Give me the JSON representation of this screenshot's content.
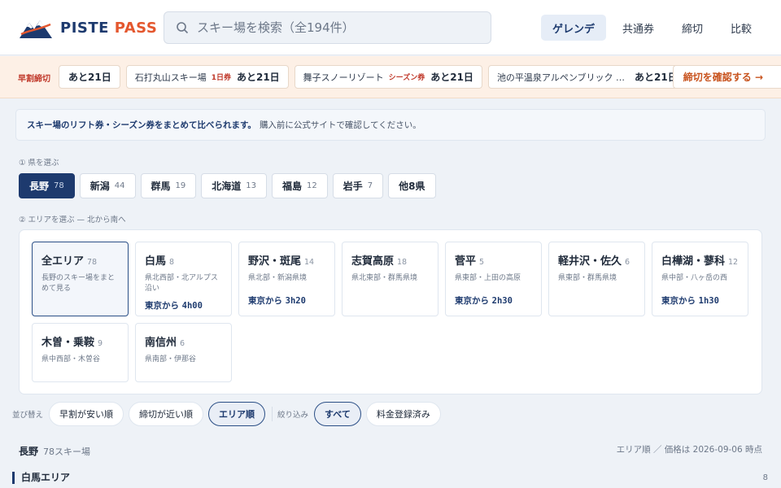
{
  "brand": {
    "name_main": "PISTE ",
    "name_accent": "PASS"
  },
  "search": {
    "placeholder": "スキー場を検索（全194件）"
  },
  "nav": [
    {
      "label": "ゲレンデ",
      "active": true
    },
    {
      "label": "共通券"
    },
    {
      "label": "締切"
    },
    {
      "label": "比較"
    }
  ],
  "ticker": {
    "label": "早割締切",
    "items": [
      {
        "name": "",
        "type": "",
        "deadline": "あと21日"
      },
      {
        "name": "石打丸山スキー場",
        "type": "1日券",
        "deadline": "あと21日"
      },
      {
        "name": "舞子スノーリゾート",
        "type": "シーズン券",
        "deadline": "あと21日"
      },
      {
        "name": "池の平温泉アルペンブリック …",
        "type": "",
        "deadline": "あと21日"
      }
    ],
    "cta": "締切を確認する →"
  },
  "notice": {
    "strong": "スキー場のリフト券・シーズン券をまとめて比べられます。",
    "rest": "購入前に公式サイトで確認してください。"
  },
  "step1": "① 県を選ぶ",
  "step2": "② エリアを選ぶ — 北から南へ",
  "prefectures": [
    {
      "name": "長野",
      "count": "78",
      "active": true
    },
    {
      "name": "新潟",
      "count": "44"
    },
    {
      "name": "群馬",
      "count": "19"
    },
    {
      "name": "北海道",
      "count": "13"
    },
    {
      "name": "福島",
      "count": "12"
    },
    {
      "name": "岩手",
      "count": "7"
    },
    {
      "name": "他8県",
      "count": ""
    }
  ],
  "areas": [
    {
      "name": "全エリア",
      "count": "78",
      "desc": "長野のスキー場をまとめて見る",
      "access_prefix": "",
      "access_time": "",
      "active": true
    },
    {
      "name": "白馬",
      "count": "8",
      "desc": "県北西部・北アルプス沿い",
      "access_prefix": "東京から",
      "access_time": "4h00"
    },
    {
      "name": "野沢・斑尾",
      "count": "14",
      "desc": "県北部・新潟県境",
      "access_prefix": "東京から",
      "access_time": "3h20"
    },
    {
      "name": "志賀高原",
      "count": "18",
      "desc": "県北東部・群馬県境",
      "access_prefix": "",
      "access_time": ""
    },
    {
      "name": "菅平",
      "count": "5",
      "desc": "県東部・上田の高原",
      "access_prefix": "東京から",
      "access_time": "2h30"
    },
    {
      "name": "軽井沢・佐久",
      "count": "6",
      "desc": "県東部・群馬県境",
      "access_prefix": "",
      "access_time": ""
    },
    {
      "name": "白樺湖・蓼科",
      "count": "12",
      "desc": "県中部・八ヶ岳の西",
      "access_prefix": "東京から",
      "access_time": "1h30"
    },
    {
      "name": "木曽・乗鞍",
      "count": "9",
      "desc": "県中西部・木曽谷",
      "access_prefix": "",
      "access_time": ""
    },
    {
      "name": "南信州",
      "count": "6",
      "desc": "県南部・伊那谷",
      "access_prefix": "",
      "access_time": ""
    }
  ],
  "sort": {
    "label": "並び替え",
    "options": [
      {
        "label": "早割が安い順"
      },
      {
        "label": "締切が近い順"
      },
      {
        "label": "エリア順",
        "active": true
      }
    ]
  },
  "filter": {
    "label": "絞り込み",
    "options": [
      {
        "label": "すべて",
        "active": true
      },
      {
        "label": "料金登録済み"
      }
    ]
  },
  "results": {
    "prefecture": "長野",
    "count_text": "78スキー場",
    "meta": "エリア順 ／ 価格は 2026-09-06 時点"
  },
  "group": {
    "name": "白馬エリア",
    "count": "8"
  },
  "colors": {
    "primary": "#1d3a6e",
    "accent": "#e4572e",
    "deadline": "#c0392b",
    "cta": "#c8531e"
  }
}
